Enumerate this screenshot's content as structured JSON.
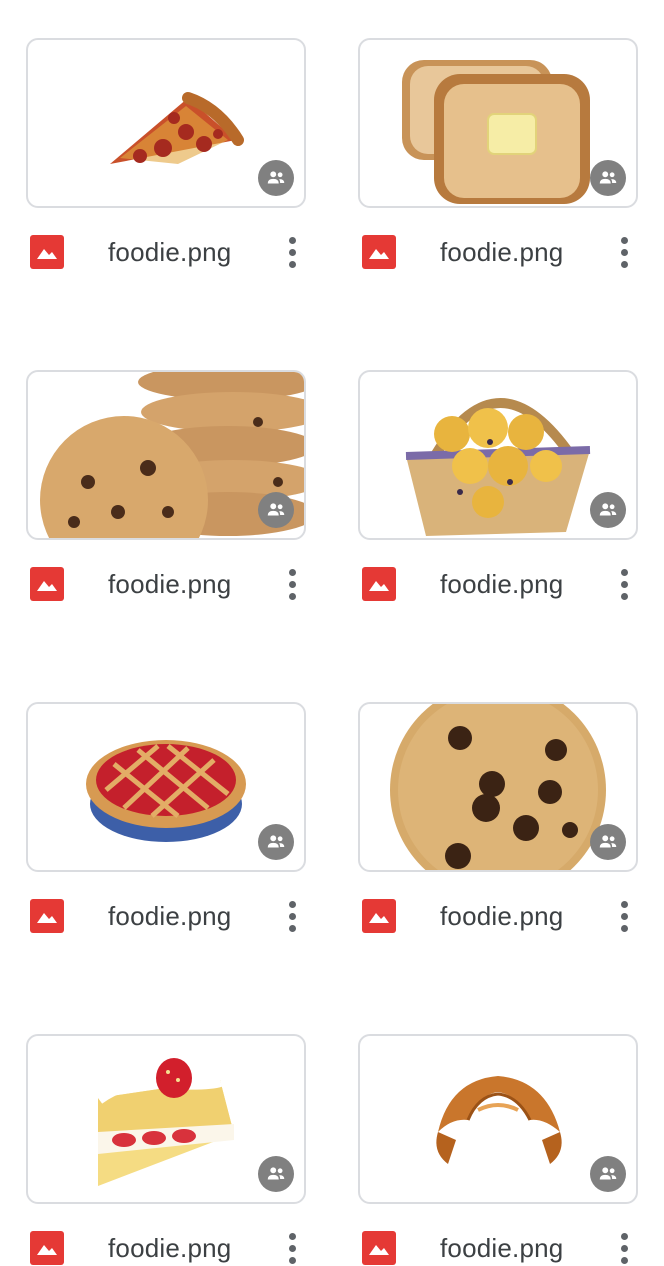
{
  "files": [
    {
      "name": "foodie.png",
      "thumbnail": "pizza-slice"
    },
    {
      "name": "foodie.png",
      "thumbnail": "toast-with-butter"
    },
    {
      "name": "foodie.png",
      "thumbnail": "cookie-stack"
    },
    {
      "name": "foodie.png",
      "thumbnail": "muffin-basket"
    },
    {
      "name": "foodie.png",
      "thumbnail": "cherry-pie"
    },
    {
      "name": "foodie.png",
      "thumbnail": "chocolate-chip-cookie"
    },
    {
      "name": "foodie.png",
      "thumbnail": "strawberry-shortcake"
    },
    {
      "name": "foodie.png",
      "thumbnail": "croissant"
    }
  ],
  "icons": {
    "shared": "people-icon",
    "file_type": "image-file-icon",
    "menu": "more-vert-icon"
  },
  "colors": {
    "image_file_icon": "#e53935",
    "shared_badge": "#808080",
    "card_border": "#dadce0",
    "text": "#3c4043"
  }
}
